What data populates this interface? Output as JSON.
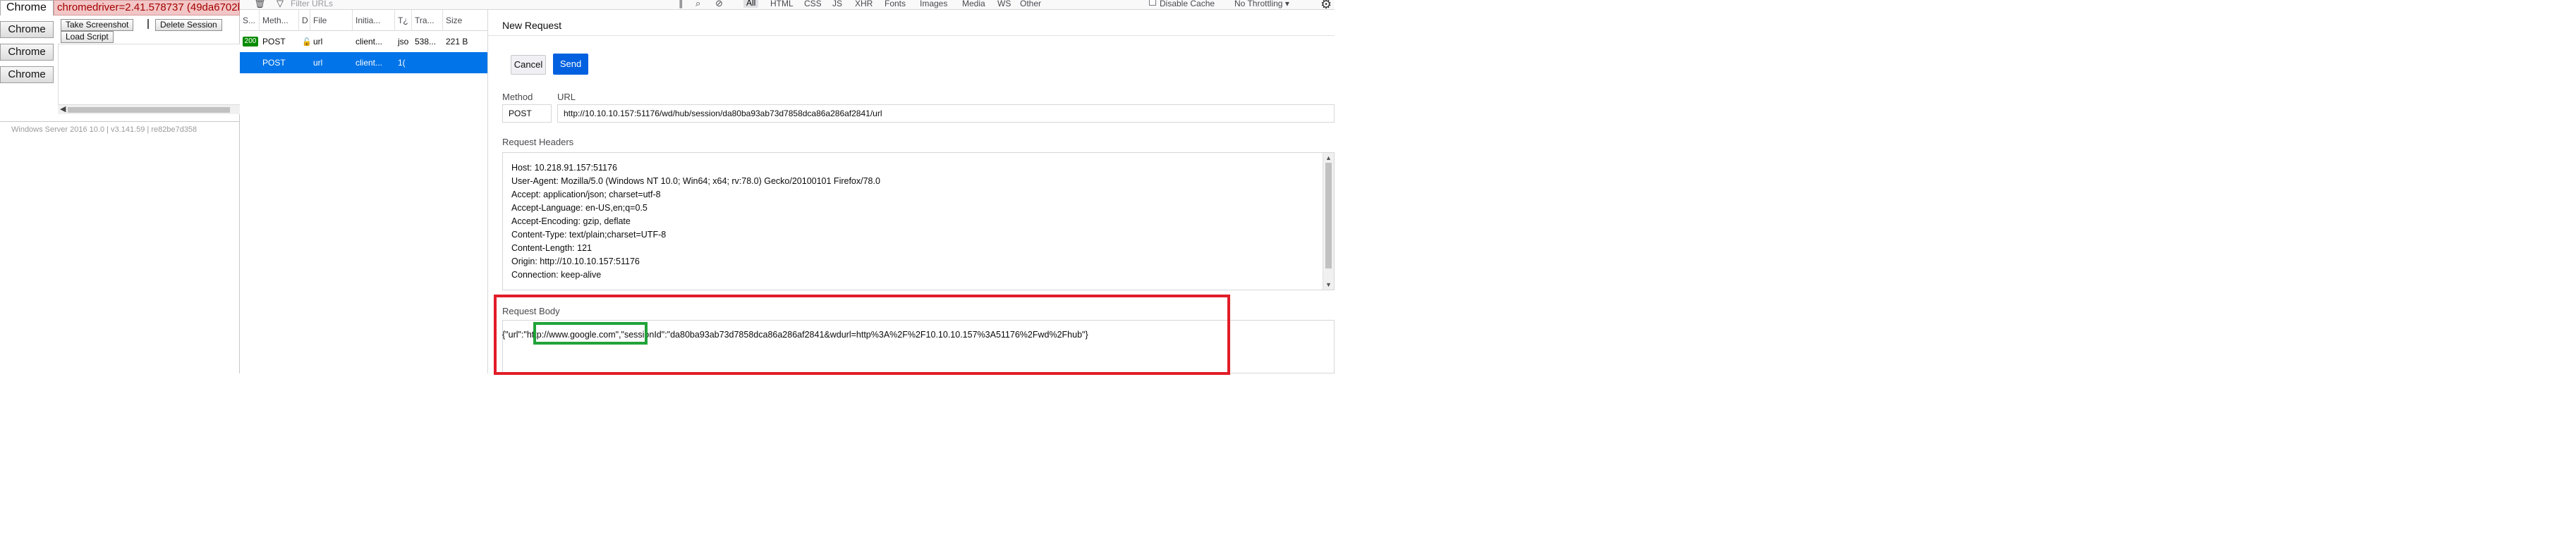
{
  "grid_console": {
    "tab_label": "Chrome",
    "version_text": "chromedriver=2.41.578737 (49da6702b",
    "browser_buttons": [
      "Chrome",
      "Chrome",
      "Chrome"
    ],
    "take_screenshot_label": "Take Screenshot",
    "delete_session_label": "Delete Session",
    "load_script_label": "Load Script",
    "footer": "Windows Server 2016 10.0 | v3.141.59 | re82be7d358"
  },
  "devtools_toolbar": {
    "filter_placeholder": "Filter URLs",
    "filters": [
      "All",
      "HTML",
      "CSS",
      "JS",
      "XHR",
      "Fonts",
      "Images",
      "Media",
      "WS",
      "Other"
    ],
    "active_filter": "All",
    "disable_cache_label": "Disable Cache",
    "throttle_label": "No Throttling ▾",
    "icons": [
      "trash-icon",
      "funnel-icon",
      "search-icon",
      "block-icon",
      "gear-icon"
    ]
  },
  "request_list": {
    "columns": [
      "S...",
      "Meth...",
      "D",
      "File",
      "Initia...",
      "T¿",
      "Tra...",
      "Size"
    ],
    "rows": [
      {
        "status": "200",
        "method": "POST",
        "file": "url",
        "initiator": "client...",
        "type": "jso",
        "transferred": "538...",
        "size": "221 B",
        "selected": false
      },
      {
        "status": "",
        "method": "POST",
        "file": "url",
        "initiator": "client...",
        "type": "1(",
        "transferred": "",
        "size": "",
        "selected": true
      }
    ],
    "colors": {
      "selected_row": "#0074e8",
      "status_ok": "#058b00"
    }
  },
  "details": {
    "title": "New Request",
    "cancel_label": "Cancel",
    "send_label": "Send",
    "method_label": "Method",
    "method_value": "POST",
    "url_label": "URL",
    "url_value": "http://10.10.10.157:51176/wd/hub/session/da80ba93ab73d7858dca86a286af2841/url",
    "headers_label": "Request Headers",
    "headers": [
      "Host: 10.218.91.157:51176",
      "User-Agent: Mozilla/5.0 (Windows NT 10.0; Win64; x64; rv:78.0) Gecko/20100101 Firefox/78.0",
      "Accept: application/json; charset=utf-8",
      "Accept-Language: en-US,en;q=0.5",
      "Accept-Encoding: gzip, deflate",
      "Content-Type: text/plain;charset=UTF-8",
      "Content-Length: 121",
      "Origin: http://10.10.10.157:51176",
      "Connection: keep-alive"
    ],
    "body_label": "Request Body",
    "body_value": "{\"url\":\"http://www.google.com\",\"sessionId\":\"da80ba93ab73d7858dca86a286af2841&wdurl=http%3A%2F%2F10.10.10.157%3A51176%2Fwd%2Fhub\"}",
    "colors": {
      "send_button": "#0060df",
      "highlight_red": "#e11d28",
      "highlight_green": "#22a33a"
    }
  }
}
